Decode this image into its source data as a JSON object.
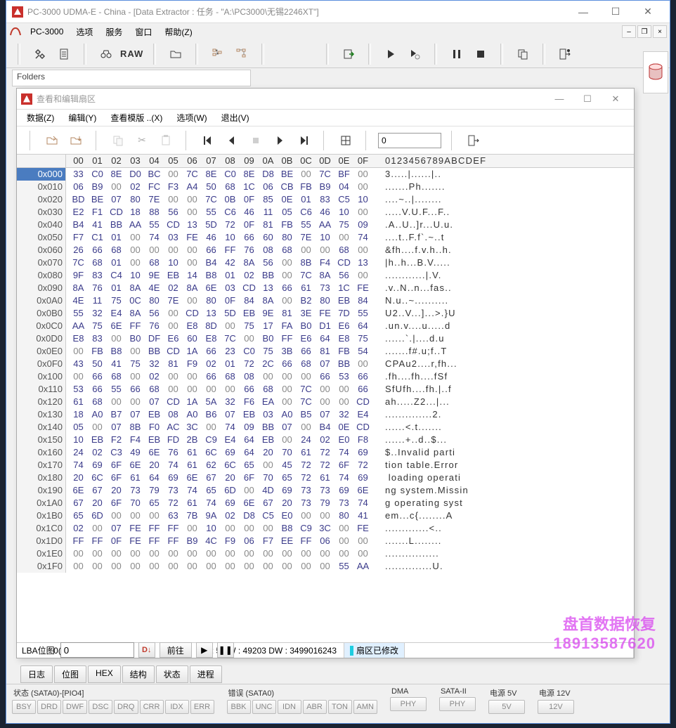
{
  "app": {
    "title": "PC-3000 UDMA-E - China - [Data Extractor : 任务 - \"A:\\PC3000\\无锡2246XT\"]",
    "brand": "PC-3000"
  },
  "main_menu": [
    "选项",
    "服务",
    "窗口",
    "帮助(Z)"
  ],
  "folders_label": "Folders",
  "hex": {
    "title": "查看和编辑扇区",
    "menu": [
      "数据(Z)",
      "编辑(Y)",
      "查看模版 ..(X)",
      "选项(W)",
      "退出(V)"
    ],
    "goto_value": "0",
    "col_header": [
      "00",
      "01",
      "02",
      "03",
      "04",
      "05",
      "06",
      "07",
      "08",
      "09",
      "0A",
      "0B",
      "0C",
      "0D",
      "0E",
      "0F"
    ],
    "ascii_header": "0123456789ABCDEF",
    "rows": [
      {
        "off": "0x000",
        "b": [
          "33",
          "C0",
          "8E",
          "D0",
          "BC",
          "00",
          "7C",
          "8E",
          "C0",
          "8E",
          "D8",
          "BE",
          "00",
          "7C",
          "BF",
          "00"
        ],
        "a": "3.....|......|.."
      },
      {
        "off": "0x010",
        "b": [
          "06",
          "B9",
          "00",
          "02",
          "FC",
          "F3",
          "A4",
          "50",
          "68",
          "1C",
          "06",
          "CB",
          "FB",
          "B9",
          "04",
          "00"
        ],
        "a": ".......Ph......."
      },
      {
        "off": "0x020",
        "b": [
          "BD",
          "BE",
          "07",
          "80",
          "7E",
          "00",
          "00",
          "7C",
          "0B",
          "0F",
          "85",
          "0E",
          "01",
          "83",
          "C5",
          "10"
        ],
        "a": "....~..|........"
      },
      {
        "off": "0x030",
        "b": [
          "E2",
          "F1",
          "CD",
          "18",
          "88",
          "56",
          "00",
          "55",
          "C6",
          "46",
          "11",
          "05",
          "C6",
          "46",
          "10",
          "00"
        ],
        "a": ".....V.U.F...F.."
      },
      {
        "off": "0x040",
        "b": [
          "B4",
          "41",
          "BB",
          "AA",
          "55",
          "CD",
          "13",
          "5D",
          "72",
          "0F",
          "81",
          "FB",
          "55",
          "AA",
          "75",
          "09"
        ],
        "a": ".A..U..]r...U.u."
      },
      {
        "off": "0x050",
        "b": [
          "F7",
          "C1",
          "01",
          "00",
          "74",
          "03",
          "FE",
          "46",
          "10",
          "66",
          "60",
          "80",
          "7E",
          "10",
          "00",
          "74"
        ],
        "a": "....t..F.f`.~..t"
      },
      {
        "off": "0x060",
        "b": [
          "26",
          "66",
          "68",
          "00",
          "00",
          "00",
          "00",
          "66",
          "FF",
          "76",
          "08",
          "68",
          "00",
          "00",
          "68",
          "00"
        ],
        "a": "&fh....f.v.h..h."
      },
      {
        "off": "0x070",
        "b": [
          "7C",
          "68",
          "01",
          "00",
          "68",
          "10",
          "00",
          "B4",
          "42",
          "8A",
          "56",
          "00",
          "8B",
          "F4",
          "CD",
          "13"
        ],
        "a": "|h..h...B.V....."
      },
      {
        "off": "0x080",
        "b": [
          "9F",
          "83",
          "C4",
          "10",
          "9E",
          "EB",
          "14",
          "B8",
          "01",
          "02",
          "BB",
          "00",
          "7C",
          "8A",
          "56",
          "00"
        ],
        "a": "............|.V."
      },
      {
        "off": "0x090",
        "b": [
          "8A",
          "76",
          "01",
          "8A",
          "4E",
          "02",
          "8A",
          "6E",
          "03",
          "CD",
          "13",
          "66",
          "61",
          "73",
          "1C",
          "FE"
        ],
        "a": ".v..N..n...fas.."
      },
      {
        "off": "0x0A0",
        "b": [
          "4E",
          "11",
          "75",
          "0C",
          "80",
          "7E",
          "00",
          "80",
          "0F",
          "84",
          "8A",
          "00",
          "B2",
          "80",
          "EB",
          "84"
        ],
        "a": "N.u..~.........."
      },
      {
        "off": "0x0B0",
        "b": [
          "55",
          "32",
          "E4",
          "8A",
          "56",
          "00",
          "CD",
          "13",
          "5D",
          "EB",
          "9E",
          "81",
          "3E",
          "FE",
          "7D",
          "55"
        ],
        "a": "U2..V...]...>.}U"
      },
      {
        "off": "0x0C0",
        "b": [
          "AA",
          "75",
          "6E",
          "FF",
          "76",
          "00",
          "E8",
          "8D",
          "00",
          "75",
          "17",
          "FA",
          "B0",
          "D1",
          "E6",
          "64"
        ],
        "a": ".un.v....u.....d"
      },
      {
        "off": "0x0D0",
        "b": [
          "E8",
          "83",
          "00",
          "B0",
          "DF",
          "E6",
          "60",
          "E8",
          "7C",
          "00",
          "B0",
          "FF",
          "E6",
          "64",
          "E8",
          "75"
        ],
        "a": "......`.|....d.u"
      },
      {
        "off": "0x0E0",
        "b": [
          "00",
          "FB",
          "B8",
          "00",
          "BB",
          "CD",
          "1A",
          "66",
          "23",
          "C0",
          "75",
          "3B",
          "66",
          "81",
          "FB",
          "54"
        ],
        "a": ".......f#.u;f..T"
      },
      {
        "off": "0x0F0",
        "b": [
          "43",
          "50",
          "41",
          "75",
          "32",
          "81",
          "F9",
          "02",
          "01",
          "72",
          "2C",
          "66",
          "68",
          "07",
          "BB",
          "00"
        ],
        "a": "CPAu2....r,fh..."
      },
      {
        "off": "0x100",
        "b": [
          "00",
          "66",
          "68",
          "00",
          "02",
          "00",
          "00",
          "66",
          "68",
          "08",
          "00",
          "00",
          "00",
          "66",
          "53",
          "66"
        ],
        "a": ".fh....fh....fSf"
      },
      {
        "off": "0x110",
        "b": [
          "53",
          "66",
          "55",
          "66",
          "68",
          "00",
          "00",
          "00",
          "00",
          "66",
          "68",
          "00",
          "7C",
          "00",
          "00",
          "66"
        ],
        "a": "SfUfh....fh.|..f"
      },
      {
        "off": "0x120",
        "b": [
          "61",
          "68",
          "00",
          "00",
          "07",
          "CD",
          "1A",
          "5A",
          "32",
          "F6",
          "EA",
          "00",
          "7C",
          "00",
          "00",
          "CD"
        ],
        "a": "ah.....Z2...|..."
      },
      {
        "off": "0x130",
        "b": [
          "18",
          "A0",
          "B7",
          "07",
          "EB",
          "08",
          "A0",
          "B6",
          "07",
          "EB",
          "03",
          "A0",
          "B5",
          "07",
          "32",
          "E4"
        ],
        "a": "..............2."
      },
      {
        "off": "0x140",
        "b": [
          "05",
          "00",
          "07",
          "8B",
          "F0",
          "AC",
          "3C",
          "00",
          "74",
          "09",
          "BB",
          "07",
          "00",
          "B4",
          "0E",
          "CD"
        ],
        "a": "......<.t......."
      },
      {
        "off": "0x150",
        "b": [
          "10",
          "EB",
          "F2",
          "F4",
          "EB",
          "FD",
          "2B",
          "C9",
          "E4",
          "64",
          "EB",
          "00",
          "24",
          "02",
          "E0",
          "F8"
        ],
        "a": "......+..d..$..."
      },
      {
        "off": "0x160",
        "b": [
          "24",
          "02",
          "C3",
          "49",
          "6E",
          "76",
          "61",
          "6C",
          "69",
          "64",
          "20",
          "70",
          "61",
          "72",
          "74",
          "69"
        ],
        "a": "$..Invalid parti"
      },
      {
        "off": "0x170",
        "b": [
          "74",
          "69",
          "6F",
          "6E",
          "20",
          "74",
          "61",
          "62",
          "6C",
          "65",
          "00",
          "45",
          "72",
          "72",
          "6F",
          "72"
        ],
        "a": "tion table.Error"
      },
      {
        "off": "0x180",
        "b": [
          "20",
          "6C",
          "6F",
          "61",
          "64",
          "69",
          "6E",
          "67",
          "20",
          "6F",
          "70",
          "65",
          "72",
          "61",
          "74",
          "69"
        ],
        "a": " loading operati"
      },
      {
        "off": "0x190",
        "b": [
          "6E",
          "67",
          "20",
          "73",
          "79",
          "73",
          "74",
          "65",
          "6D",
          "00",
          "4D",
          "69",
          "73",
          "73",
          "69",
          "6E"
        ],
        "a": "ng system.Missin"
      },
      {
        "off": "0x1A0",
        "b": [
          "67",
          "20",
          "6F",
          "70",
          "65",
          "72",
          "61",
          "74",
          "69",
          "6E",
          "67",
          "20",
          "73",
          "79",
          "73",
          "74"
        ],
        "a": "g operating syst"
      },
      {
        "off": "0x1B0",
        "b": [
          "65",
          "6D",
          "00",
          "00",
          "00",
          "63",
          "7B",
          "9A",
          "02",
          "D8",
          "C5",
          "E0",
          "00",
          "00",
          "80",
          "41"
        ],
        "a": "em...c{........A"
      },
      {
        "off": "0x1C0",
        "b": [
          "02",
          "00",
          "07",
          "FE",
          "FF",
          "FF",
          "00",
          "10",
          "00",
          "00",
          "00",
          "B8",
          "C9",
          "3C",
          "00",
          "FE"
        ],
        "a": ".............<.."
      },
      {
        "off": "0x1D0",
        "b": [
          "FF",
          "FF",
          "0F",
          "FE",
          "FF",
          "FF",
          "B9",
          "4C",
          "F9",
          "06",
          "F7",
          "EE",
          "FF",
          "06",
          "00",
          "00"
        ],
        "a": ".......L........"
      },
      {
        "off": "0x1E0",
        "b": [
          "00",
          "00",
          "00",
          "00",
          "00",
          "00",
          "00",
          "00",
          "00",
          "00",
          "00",
          "00",
          "00",
          "00",
          "00",
          "00"
        ],
        "a": "................"
      },
      {
        "off": "0x1F0",
        "b": [
          "00",
          "00",
          "00",
          "00",
          "00",
          "00",
          "00",
          "00",
          "00",
          "00",
          "00",
          "00",
          "00",
          "00",
          "55",
          "AA"
        ],
        "a": "..............U."
      }
    ],
    "status": {
      "pos": "0($00)",
      "info": "3 : 51 W : 49203 DW : 3499016243",
      "modified": "扇区已修改"
    }
  },
  "lba": {
    "label": "LBA位图",
    "value": "0",
    "go": "前往"
  },
  "tabs": [
    "日志",
    "位图",
    "HEX",
    "结构",
    "状态",
    "进程"
  ],
  "watermark": {
    "l1": "盘首数据恢复",
    "l2": "18913587620"
  },
  "status_bar": {
    "g1": {
      "hdr": "状态 (SATA0)-[PIO4]",
      "cells": [
        "BSY",
        "DRD",
        "DWF",
        "DSC",
        "DRQ",
        "CRR",
        "IDX",
        "ERR"
      ]
    },
    "g2": {
      "hdr": "错误 (SATA0)",
      "cells": [
        "BBK",
        "UNC",
        "IDN",
        "ABR",
        "TON",
        "AMN"
      ]
    },
    "g3": {
      "hdr": "DMA",
      "cells": [
        "PHY"
      ]
    },
    "g4": {
      "hdr": "SATA-II",
      "cells": [
        "PHY"
      ]
    },
    "g5": {
      "hdr": "电源 5V",
      "cells": [
        "5V"
      ]
    },
    "g6": {
      "hdr": "电源 12V",
      "cells": [
        "12V"
      ]
    }
  }
}
